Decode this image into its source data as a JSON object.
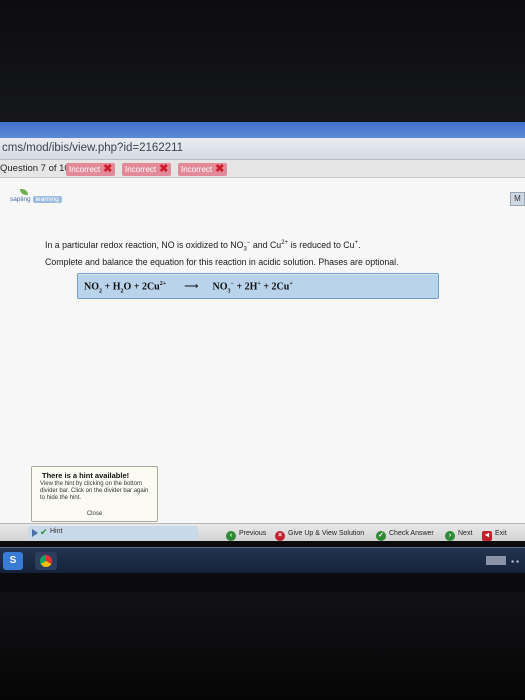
{
  "browser": {
    "url": "cms/mod/ibis/view.php?id=2162211"
  },
  "question_bar": {
    "label": "Question 7 of 10",
    "attempts": [
      {
        "label": "Incorrect",
        "status": "incorrect"
      },
      {
        "label": "Incorrect",
        "status": "incorrect"
      },
      {
        "label": "Incorrect",
        "status": "incorrect"
      }
    ]
  },
  "side_tab": "M",
  "logo": {
    "brand": "sapling",
    "sub": "learning"
  },
  "prompt": {
    "line1_a": "In a particular redox reaction, NO is oxidized to NO",
    "line1_b": "3",
    "line1_c": "−",
    "line1_d": " and Cu",
    "line1_e": "2+",
    "line1_f": " is reduced to Cu",
    "line1_g": "+",
    "line1_h": ".",
    "line2": "Complete and balance the equation for this reaction in acidic solution. Phases are optional."
  },
  "equation": {
    "left": {
      "t1": "NO",
      "t1_sub": "2",
      "t2": " + H",
      "t2_sub": "2",
      "t3": "O + 2Cu",
      "t3_sup": "2+"
    },
    "arrow": "⟶",
    "right": {
      "t1": "NO",
      "t1_sub": "3",
      "t1_sup": "−",
      "t2": " + 2H",
      "t2_sup": "+",
      "t3": " + 2Cu",
      "t3_sup": "+"
    }
  },
  "hint_popup": {
    "title": "There is a hint available!",
    "body": "View the hint by clicking on the bottom divider bar. Click on the divider bar again to hide the hint.",
    "close": "Close"
  },
  "bottom_bar": {
    "hint": "Hint",
    "previous": "Previous",
    "give_up": "Give Up & View Solution",
    "check": "Check Answer",
    "next": "Next",
    "exit": "Exit"
  },
  "taskbar": {
    "start": "S"
  },
  "colors": {
    "incorrect": "#d01d2c",
    "equation_box": "#b9d3ea",
    "hint_green": "#2c8b2f"
  }
}
